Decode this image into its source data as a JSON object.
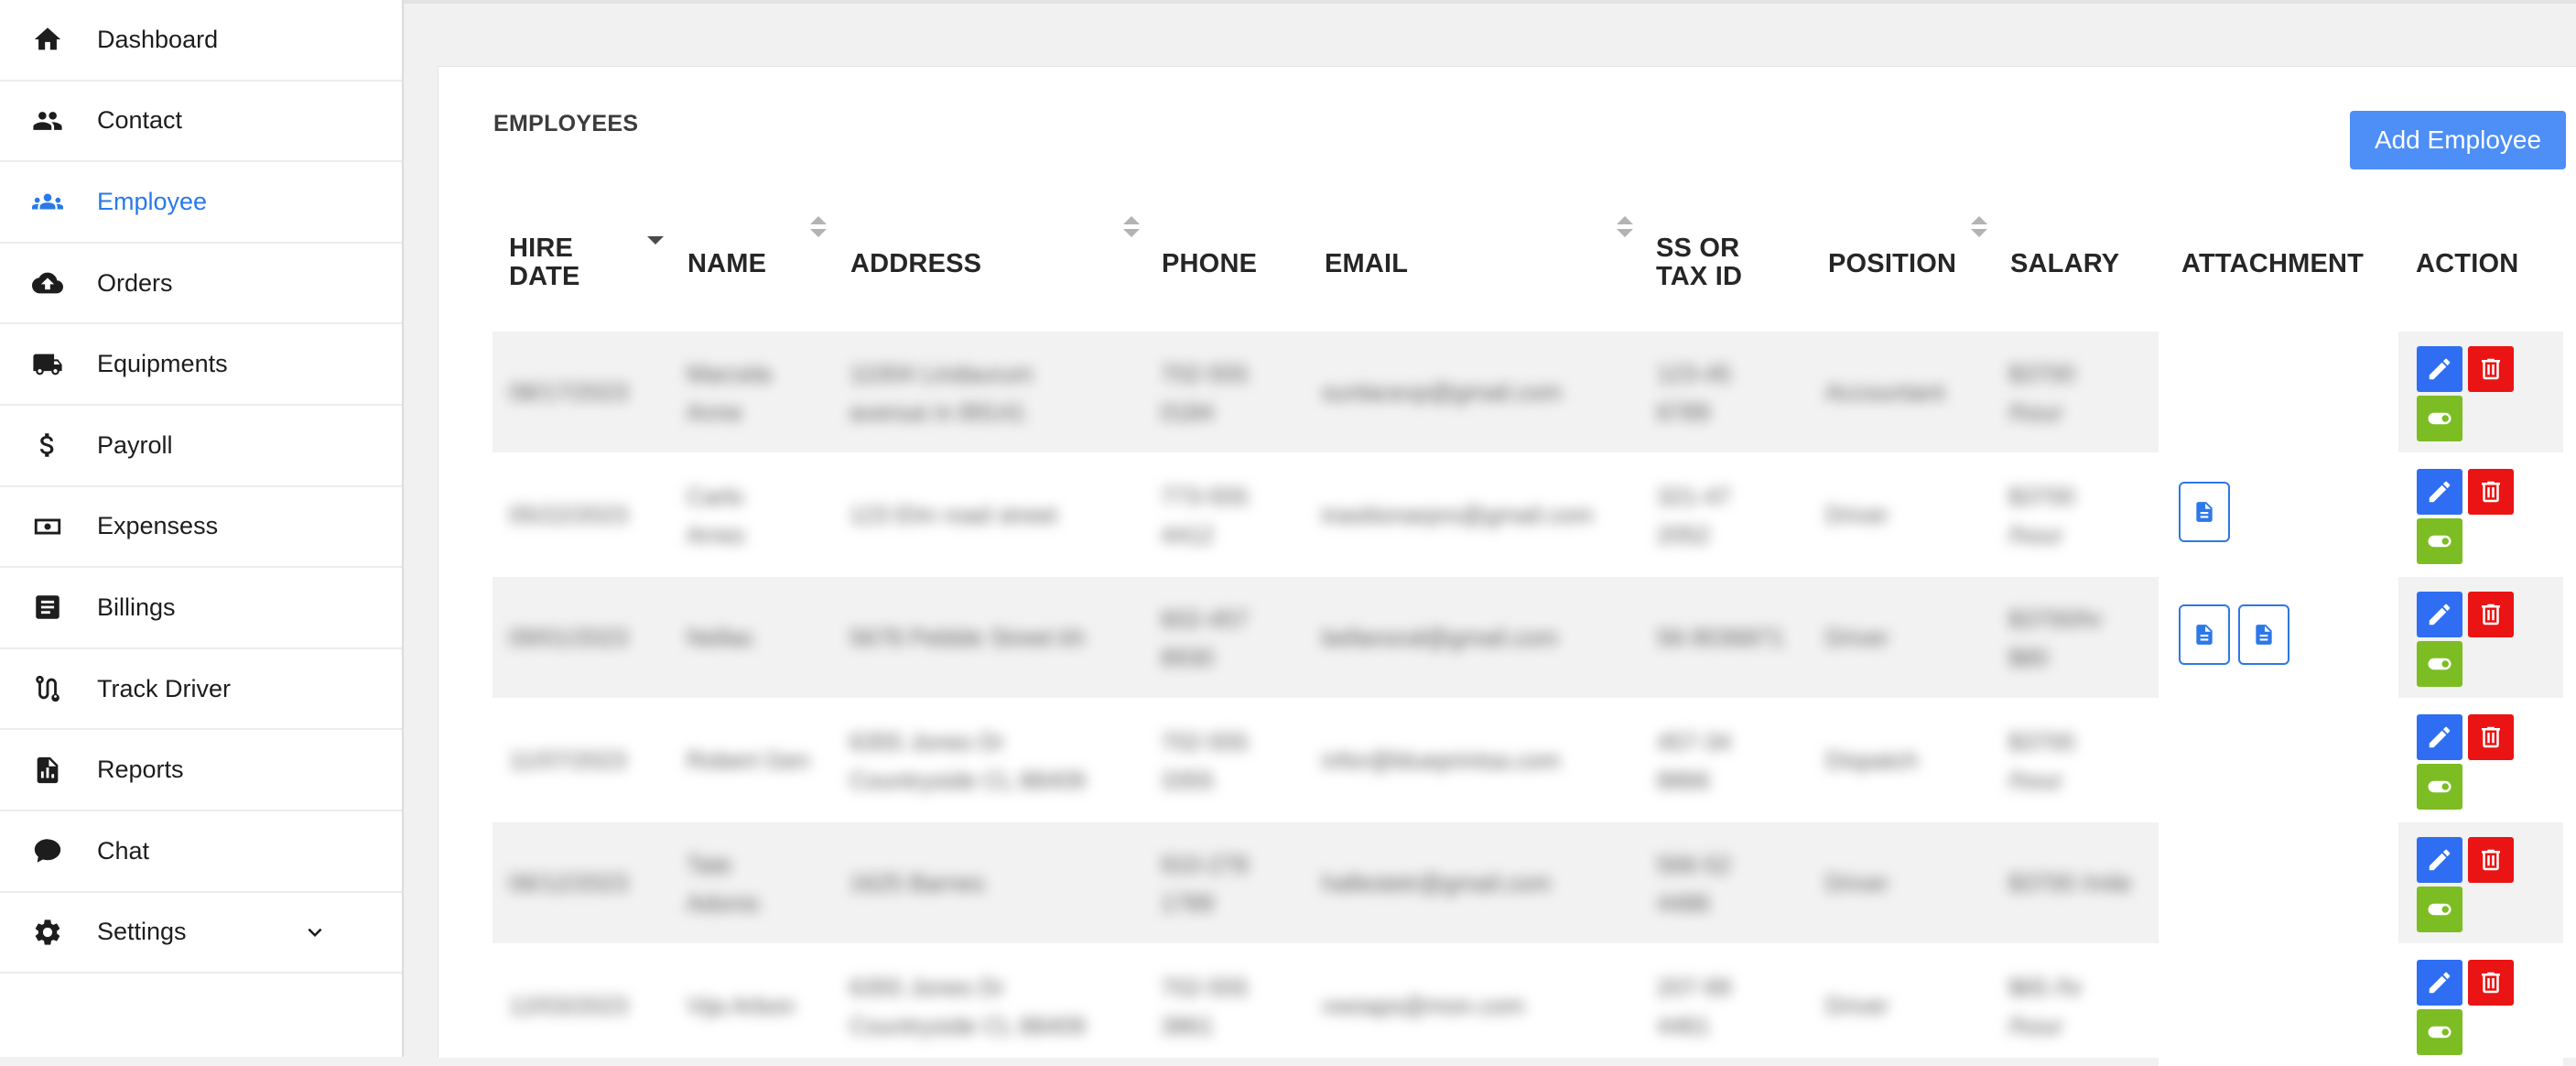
{
  "sidebar": {
    "items": [
      {
        "label": "Dashboard",
        "icon": "home-icon",
        "active": false
      },
      {
        "label": "Contact",
        "icon": "people-icon",
        "active": false
      },
      {
        "label": "Employee",
        "icon": "group-icon",
        "active": true
      },
      {
        "label": "Orders",
        "icon": "cloud-upload-icon",
        "active": false
      },
      {
        "label": "Equipments",
        "icon": "truck-icon",
        "active": false
      },
      {
        "label": "Payroll",
        "icon": "dollar-icon",
        "active": false
      },
      {
        "label": "Expensess",
        "icon": "money-icon",
        "active": false
      },
      {
        "label": "Billings",
        "icon": "list-icon",
        "active": false
      },
      {
        "label": "Track Driver",
        "icon": "route-icon",
        "active": false
      },
      {
        "label": "Reports",
        "icon": "report-icon",
        "active": false
      },
      {
        "label": "Chat",
        "icon": "chat-icon",
        "active": false
      },
      {
        "label": "Settings",
        "icon": "gear-icon",
        "active": false,
        "expandable": true
      }
    ]
  },
  "main": {
    "title": "EMPLOYEES",
    "add_button": "Add Employee"
  },
  "table": {
    "columns": {
      "hire_date": {
        "label": "HIRE DATE",
        "line1": "HIRE",
        "line2": "DATE"
      },
      "name": {
        "label": "NAME"
      },
      "address": {
        "label": "ADDRESS"
      },
      "phone": {
        "label": "PHONE"
      },
      "email": {
        "label": "EMAIL"
      },
      "ss_tax": {
        "label": "SS OR TAX ID",
        "line1": "SS OR",
        "line2": "TAX ID"
      },
      "position": {
        "label": "POSITION"
      },
      "salary": {
        "label": "SALARY"
      },
      "attachment": {
        "label": "ATTACHMENT"
      },
      "action": {
        "label": "ACTION"
      }
    },
    "rows": [
      {
        "hire_date": "08/17/2023",
        "name": [
          "Marcela",
          "Anne"
        ],
        "address": [
          "11004 Lindaurum",
          "avenue in 89141"
        ],
        "phone": [
          "702-555",
          "0184"
        ],
        "email": "sunlacexp@gmail.com",
        "ss_tax": [
          "123-45",
          "6789"
        ],
        "position": "Accountant",
        "salary": [
          "$3700",
          "/hour"
        ],
        "attachments": 0
      },
      {
        "hire_date": "05/22/2023",
        "name": [
          "Carlo",
          "Arreo"
        ],
        "address": [
          "123 Elm road street"
        ],
        "phone": [
          "773-555",
          "4412"
        ],
        "email": "trasitionarpro@gmail.com",
        "ss_tax": [
          "321-47",
          "2052"
        ],
        "position": "Driver",
        "salary": [
          "$3700",
          "/hour"
        ],
        "attachments": 1
      },
      {
        "hire_date": "09/01/2023",
        "name": [
          "Nellas"
        ],
        "address": [
          "5678 Pebble Street kh"
        ],
        "phone": [
          "602-457",
          "8930"
        ],
        "email": "bellanoral@gmail.com",
        "ss_tax": [
          "56-9036871"
        ],
        "position": "Driver",
        "salary": [
          "$3700/hr",
          "$80"
        ],
        "attachments": 2
      },
      {
        "hire_date": "11/07/2023",
        "name": [
          "Robert Gen"
        ],
        "address": [
          "6355 Jones Dr",
          "Countryside CL 88409"
        ],
        "phone": [
          "702-555",
          "3355"
        ],
        "email": "infor@blueprintsa.com",
        "ss_tax": [
          "457-34",
          "8866"
        ],
        "position": "Dispatch",
        "salary": [
          "$3700",
          "/hour"
        ],
        "attachments": 0
      },
      {
        "hire_date": "06/12/2023",
        "name": [
          "Tate",
          "Adonis"
        ],
        "address": [
          "1625 Barnes"
        ],
        "phone": [
          "910-278",
          "1789"
        ],
        "email": "hallestetr@gmail.com",
        "ss_tax": [
          "566-52",
          "4486"
        ],
        "position": "Driver",
        "salary": [
          "$3700 /mile"
        ],
        "attachments": 0
      },
      {
        "hire_date": "12/03/2023",
        "name": [
          "Vija Arbon"
        ],
        "address": [
          "6355 Jones Dr",
          "Countryside CL 88409"
        ],
        "phone": [
          "702-555",
          "3861"
        ],
        "email": "vwoaps@mon.com",
        "ss_tax": [
          "207-99",
          "4461"
        ],
        "position": "Driver",
        "salary": [
          "$65 /hr",
          "/hour"
        ],
        "attachments": 0
      }
    ]
  },
  "colors": {
    "accent": "#2979e8",
    "add_button": "#4d8ef7",
    "edit": "#2f6ef2",
    "delete": "#ea1414",
    "toggle": "#7cbd24"
  }
}
